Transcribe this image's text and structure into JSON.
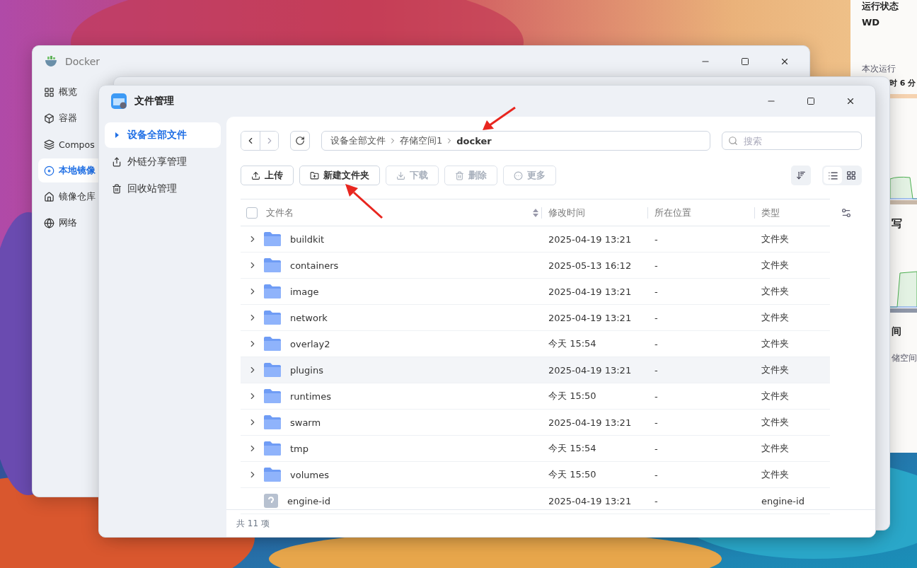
{
  "right_panel": {
    "heading": "运行状态",
    "value": "WD",
    "label": "本次运行",
    "uptime": "时 6 分",
    "section_2": "写",
    "section_3": "间",
    "section_3_label": "储空间"
  },
  "docker_window": {
    "title": "Docker",
    "sidebar": [
      {
        "label": "概览",
        "selected": false
      },
      {
        "label": "容器",
        "selected": false
      },
      {
        "label": "Compos",
        "selected": false
      },
      {
        "label": "本地镜像",
        "selected": true
      },
      {
        "label": "镜像仓库",
        "selected": false
      },
      {
        "label": "网络",
        "selected": false
      }
    ]
  },
  "file_window": {
    "title": "文件管理",
    "sidebar": [
      {
        "label": "设备全部文件",
        "selected": true
      },
      {
        "label": "外链分享管理",
        "selected": false
      },
      {
        "label": "回收站管理",
        "selected": false
      }
    ],
    "breadcrumb": [
      "设备全部文件",
      "存储空间1",
      "docker"
    ],
    "search": {
      "placeholder": "搜索"
    },
    "toolbar": [
      {
        "label": "上传",
        "disabled": false
      },
      {
        "label": "新建文件夹",
        "disabled": false
      },
      {
        "label": "下载",
        "disabled": true
      },
      {
        "label": "删除",
        "disabled": true
      },
      {
        "label": "更多",
        "disabled": true
      }
    ],
    "views": [
      {
        "kind": "list",
        "selected": true
      },
      {
        "kind": "grid",
        "selected": false
      }
    ],
    "columns": [
      "文件名",
      "修改时间",
      "所在位置",
      "类型"
    ],
    "header_checked": false,
    "rows": [
      {
        "kind": "folder",
        "name": "buildkit",
        "modified": "2025-04-19 13:21",
        "location": "-",
        "type": "文件夹",
        "highlighted": false
      },
      {
        "kind": "folder",
        "name": "containers",
        "modified": "2025-05-13 16:12",
        "location": "-",
        "type": "文件夹",
        "highlighted": false
      },
      {
        "kind": "folder",
        "name": "image",
        "modified": "2025-04-19 13:21",
        "location": "-",
        "type": "文件夹",
        "highlighted": false
      },
      {
        "kind": "folder",
        "name": "network",
        "modified": "2025-04-19 13:21",
        "location": "-",
        "type": "文件夹",
        "highlighted": false
      },
      {
        "kind": "folder",
        "name": "overlay2",
        "modified": "今天 15:54",
        "location": "-",
        "type": "文件夹",
        "highlighted": false
      },
      {
        "kind": "folder",
        "name": "plugins",
        "modified": "2025-04-19 13:21",
        "location": "-",
        "type": "文件夹",
        "highlighted": true
      },
      {
        "kind": "folder",
        "name": "runtimes",
        "modified": "今天 15:50",
        "location": "-",
        "type": "文件夹",
        "highlighted": false
      },
      {
        "kind": "folder",
        "name": "swarm",
        "modified": "2025-04-19 13:21",
        "location": "-",
        "type": "文件夹",
        "highlighted": false
      },
      {
        "kind": "folder",
        "name": "tmp",
        "modified": "今天 15:54",
        "location": "-",
        "type": "文件夹",
        "highlighted": false
      },
      {
        "kind": "folder",
        "name": "volumes",
        "modified": "今天 15:50",
        "location": "-",
        "type": "文件夹",
        "highlighted": false
      },
      {
        "kind": "file",
        "name": "engine-id",
        "modified": "2025-04-19 13:21",
        "location": "-",
        "type": "engine-id",
        "highlighted": false
      }
    ],
    "footer": "共 11 项"
  }
}
